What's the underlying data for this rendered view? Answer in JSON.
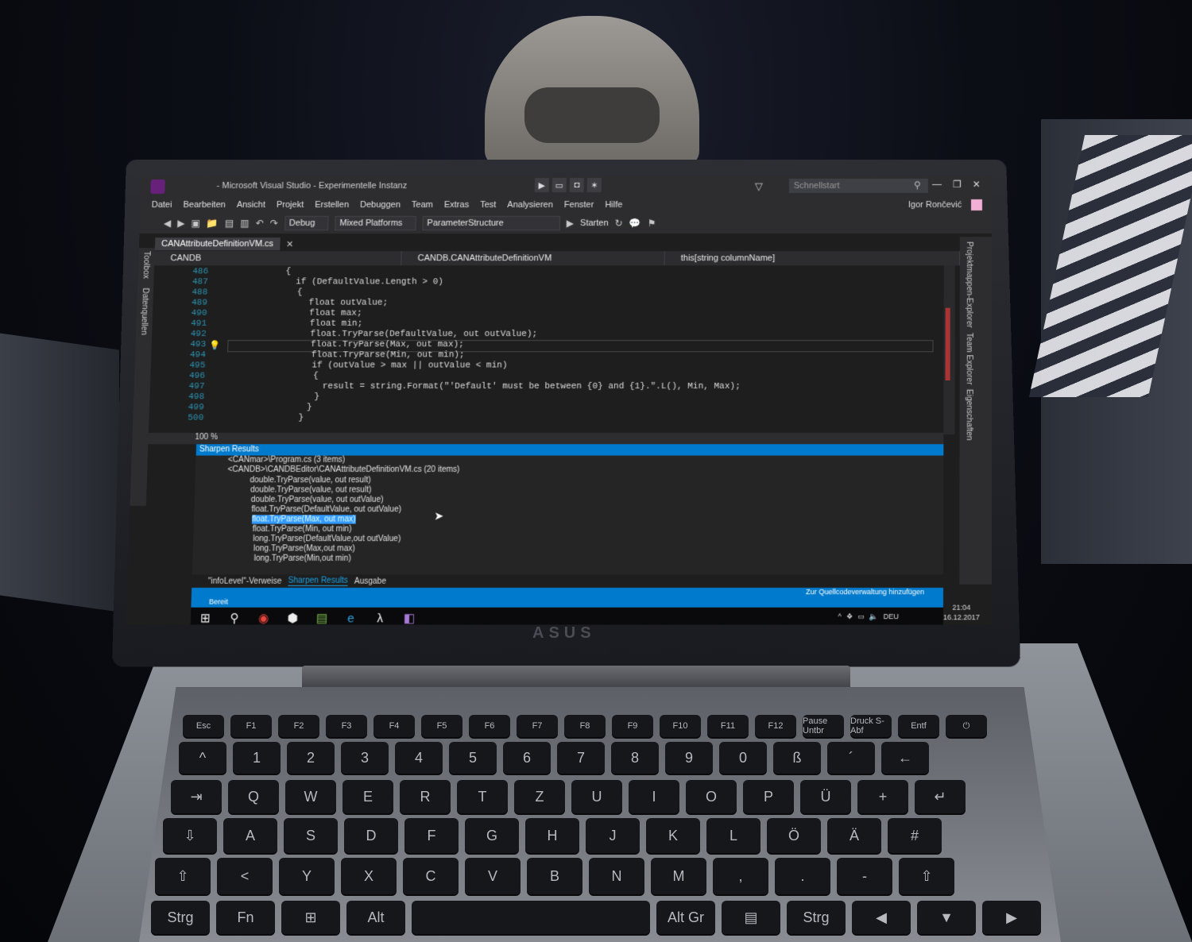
{
  "window": {
    "title": "- Microsoft Visual Studio - Experimentelle Instanz",
    "quick_launch": "Schnellstart",
    "user": "Igor Rončević"
  },
  "menu": [
    "Datei",
    "Bearbeiten",
    "Ansicht",
    "Projekt",
    "Erstellen",
    "Debuggen",
    "Team",
    "Extras",
    "Test",
    "Analysieren",
    "Fenster",
    "Hilfe"
  ],
  "toolbar": {
    "config": "Debug",
    "platform": "Mixed Platforms",
    "structure": "ParameterStructure",
    "start": "Starten"
  },
  "doc_tab": "CANAttributeDefinitionVM.cs",
  "nav": {
    "project": "CANDB",
    "class": "CANDB.CANAttributeDefinitionVM",
    "member": "this[string columnName]"
  },
  "side_left": [
    "Toolbox",
    "Datenquellen"
  ],
  "side_right": [
    "Projektmappen-Explorer",
    "Team Explorer",
    "Eigenschaften"
  ],
  "editor": {
    "lines": [
      {
        "n": "486",
        "code": "{"
      },
      {
        "n": "487",
        "code": "if (DefaultValue.Length > 0)"
      },
      {
        "n": "488",
        "code": "{"
      },
      {
        "n": "489",
        "code": "float outValue;"
      },
      {
        "n": "490",
        "code": "float max;"
      },
      {
        "n": "491",
        "code": "float min;"
      },
      {
        "n": "492",
        "code": "float.TryParse(DefaultValue, out outValue);"
      },
      {
        "n": "493",
        "code": "float.TryParse(Max, out max);"
      },
      {
        "n": "494",
        "code": "float.TryParse(Min, out min);"
      },
      {
        "n": "495",
        "code": "if (outValue > max || outValue < min)"
      },
      {
        "n": "496",
        "code": "{"
      },
      {
        "n": "497",
        "code": "result = string.Format(\"'Default' must be between {0} and {1}.\".L(), Min, Max);"
      },
      {
        "n": "498",
        "code": "}"
      },
      {
        "n": "499",
        "code": "}"
      },
      {
        "n": "500",
        "code": "}"
      }
    ],
    "zoom": "100 %"
  },
  "results": {
    "header": "Sharpen Results",
    "group_prev": "<CANmar>\\Program.cs (3 items)",
    "group": "<CANDB>\\CANDBEditor\\CANAttributeDefinitionVM.cs (20 items)",
    "items": [
      "double.TryParse(value, out result)",
      "double.TryParse(value, out result)",
      "double.TryParse(value, out outValue)",
      "float.TryParse(DefaultValue, out outValue)",
      "float.TryParse(Max, out max)",
      "float.TryParse(Min, out min)",
      "long.TryParse(DefaultValue,out outValue)",
      "long.TryParse(Max,out max)",
      "long.TryParse(Min,out min)"
    ]
  },
  "bottom_tabs": [
    "\"infoLevel\"-Verweise",
    "Sharpen Results",
    "Ausgabe"
  ],
  "status": {
    "left": "Bereit",
    "source_control": "Zur Quellcodeverwaltung hinzufügen"
  },
  "clock": {
    "time": "21:04",
    "date": "16.12.2017",
    "lang": "DEU"
  },
  "keyboard": {
    "row_fn": [
      "Esc",
      "F1",
      "F2",
      "F3",
      "F4",
      "F5",
      "F6",
      "F7",
      "F8",
      "F9",
      "F10",
      "F11",
      "F12",
      "Pause Untbr",
      "Druck S-Abf",
      "Entf",
      "⏻"
    ],
    "row1": [
      "^",
      "1",
      "2",
      "3",
      "4",
      "5",
      "6",
      "7",
      "8",
      "9",
      "0",
      "ß",
      "´",
      "←"
    ],
    "row2": [
      "⇥",
      "Q",
      "W",
      "E",
      "R",
      "T",
      "Z",
      "U",
      "I",
      "O",
      "P",
      "Ü",
      "+",
      "↵"
    ],
    "row3": [
      "⇩",
      "A",
      "S",
      "D",
      "F",
      "G",
      "H",
      "J",
      "K",
      "L",
      "Ö",
      "Ä",
      "#"
    ],
    "row4": [
      "⇧",
      "<",
      "Y",
      "X",
      "C",
      "V",
      "B",
      "N",
      "M",
      ",",
      ".",
      "-",
      "⇧"
    ],
    "row5": [
      "Strg",
      "Fn",
      "⊞",
      "Alt",
      "",
      "Alt Gr",
      "▤",
      "Strg",
      "◀",
      "▼",
      "▶"
    ]
  },
  "brand": "ASUS"
}
